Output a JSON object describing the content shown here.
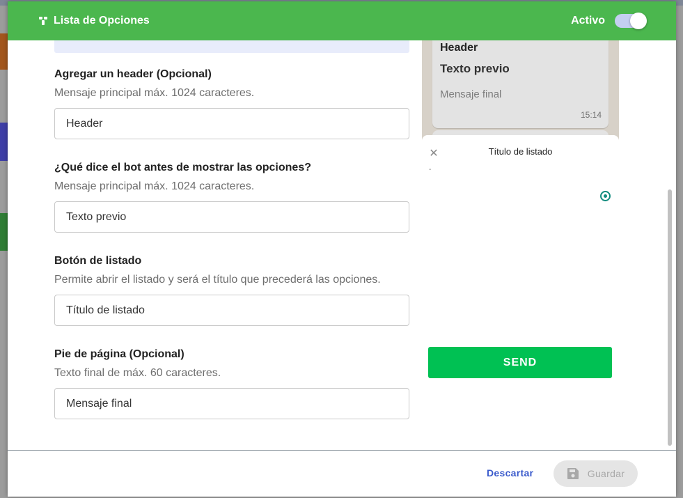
{
  "dialog": {
    "title": "Lista de Opciones",
    "status_label": "Activo",
    "toggle_on": true,
    "accent_color": "#4bb74e"
  },
  "form": {
    "fields": [
      {
        "title": "Agregar un header (Opcional)",
        "help": "Mensaje principal máx. 1024 caracteres.",
        "value": "Header"
      },
      {
        "title": "¿Qué dice el bot antes de mostrar las opciones?",
        "help": "Mensaje principal máx. 1024 caracteres.",
        "value": "Texto previo"
      },
      {
        "title": "Botón de listado",
        "help": "Permite abrir el listado y será el título que precederá las opciones.",
        "value": "Título de listado"
      },
      {
        "title": "Pie de página (Opcional)",
        "help": "Texto final de máx. 60 caracteres.",
        "value": "Mensaje final"
      }
    ]
  },
  "preview": {
    "bubble": {
      "header": "Header",
      "body": "Texto previo",
      "footer": "Mensaje final",
      "time": "15:14"
    },
    "sheet": {
      "close": "✕",
      "title": "Título de listado",
      "dash": "-",
      "send_label": "SEND"
    },
    "send_color": "#00c153",
    "radio_color": "#128c7e"
  },
  "footer": {
    "discard_label": "Descartar",
    "save_label": "Guardar",
    "discard_color": "#3b5bcc"
  }
}
